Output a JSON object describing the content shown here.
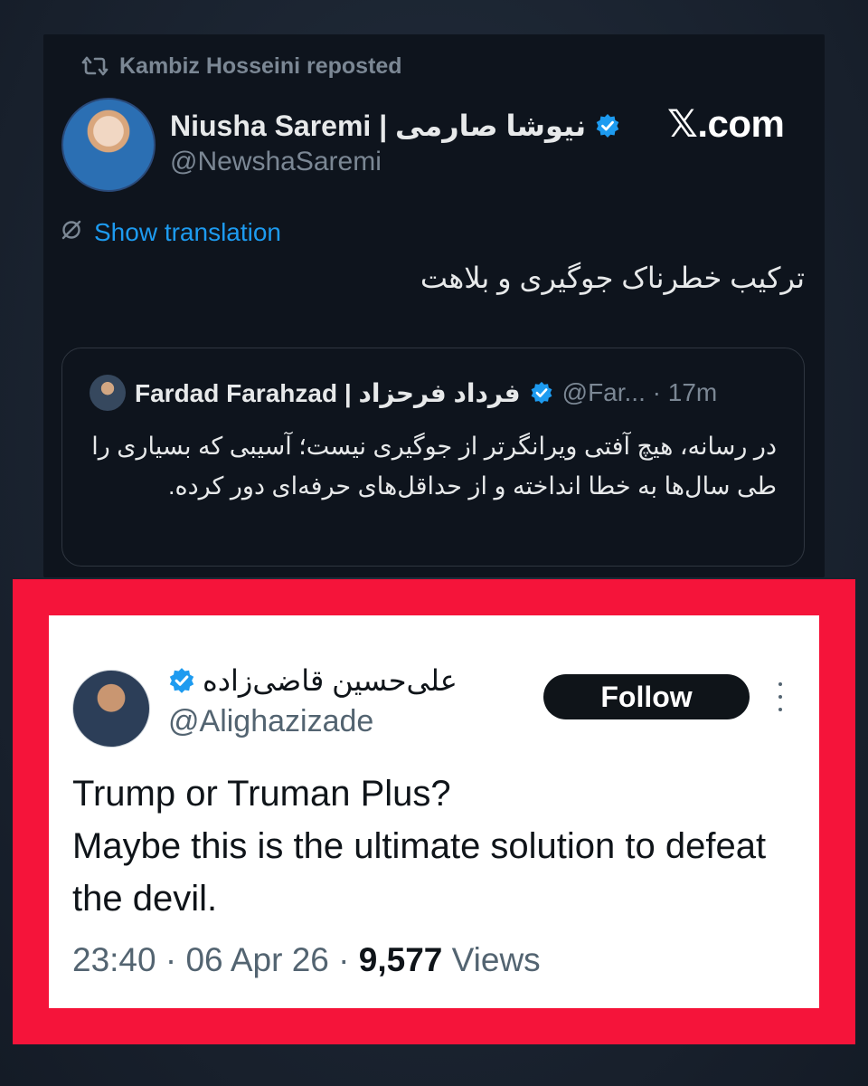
{
  "reposter": {
    "text": "Kambiz Hosseini reposted"
  },
  "tweet": {
    "author_name": "Niusha Saremi | نیوشا صارمی",
    "author_handle": "@NewshaSaremi",
    "site_label": "𝕏.com",
    "show_translation": "Show translation",
    "text": "ترکیب خطرناک جوگیری و بلاهت"
  },
  "quoted_tweet": {
    "author_name": "Fardad Farahzad | فرداد فرحزاد",
    "handle_time": "@Far... · 17m",
    "text": "در رسانه، هیچ آفتی ویرانگرتر از جوگیری نیست؛ آسیبی که بسیاری را طی سال‌ها به خطا انداخته و از حداقل‌های حرفه‌ای دور کرده."
  },
  "embedded_tweet": {
    "author_name": "علی‌حسین قاضی‌زاده",
    "author_handle": "@Alighazizade",
    "follow_label": "Follow",
    "text_line1": "Trump or Truman Plus?",
    "text_line2": "Maybe this is the ultimate solution to defeat the devil.",
    "time_date": "23:40 · 06 Apr 26 · ",
    "views_count": "9,577",
    "views_label": " Views"
  },
  "colors": {
    "accent_blue": "#1d9bf0",
    "highlight_red": "#f5143a",
    "dark_bg": "#0e141d"
  }
}
